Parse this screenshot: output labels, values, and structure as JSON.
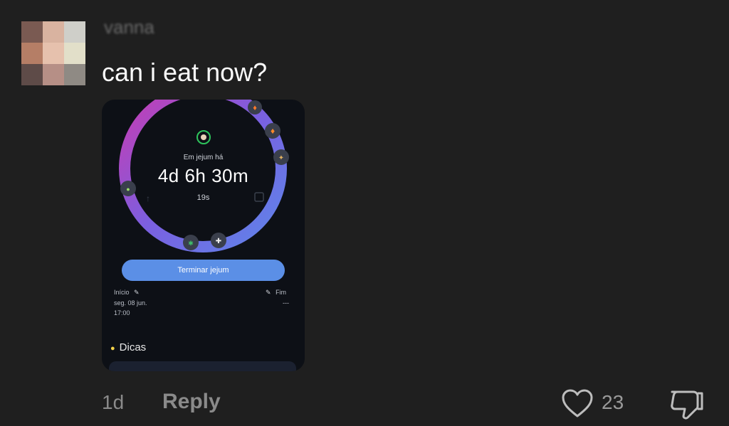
{
  "comment": {
    "username": "vanna",
    "text": "can i eat now?",
    "age": "1d",
    "reply_label": "Reply",
    "like_count": "23"
  },
  "screenshot": {
    "fasting_label": "Em jejum há",
    "fasting_time": "4d 6h 30m",
    "fasting_seconds": "19s",
    "end_button": "Terminar jejum",
    "start_label": "Início",
    "start_date": "seg. 08 jun.",
    "start_time": "17:00",
    "end_label": "Fim",
    "end_value": "---",
    "tips_label": "Dicas",
    "ring_colors": [
      "#c93bb2",
      "#7b5fe0",
      "#5d86ea"
    ]
  },
  "icons": [
    "heart-icon",
    "thumbs-down-icon",
    "pencil-icon",
    "lightbulb-icon",
    "fire-icon"
  ]
}
